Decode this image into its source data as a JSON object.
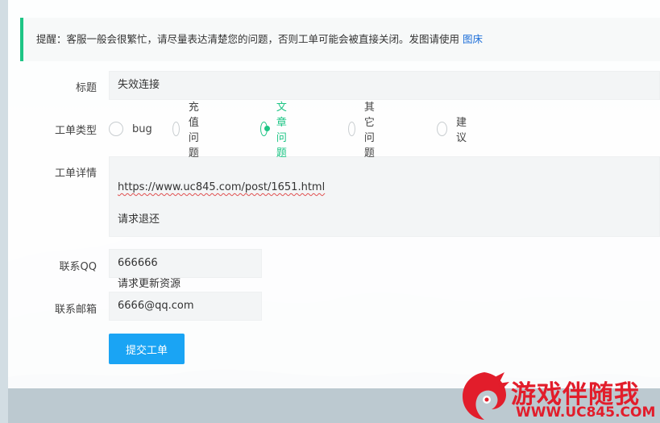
{
  "notice": {
    "text": "提醒：客服一般会很繁忙，请尽量表达清楚您的问题，否则工单可能会被直接关闭。发图请使用 ",
    "link_label": "图床"
  },
  "form": {
    "title_label": "标题",
    "title_value": "失效连接",
    "type_label": "工单类型",
    "types": [
      {
        "label": "bug",
        "checked": false
      },
      {
        "label": "充值问题",
        "checked": false
      },
      {
        "label": "文章问题",
        "checked": true
      },
      {
        "label": "其它问题",
        "checked": false
      },
      {
        "label": "建议",
        "checked": false
      }
    ],
    "detail_label": "工单详情",
    "detail_lines": [
      "https://www.uc845.com/post/1651.html",
      "请求退还",
      "",
      "请求更新资源"
    ],
    "qq_label": "联系QQ",
    "qq_value": "666666",
    "email_label": "联系邮箱",
    "email_value": "6666@qq.com",
    "submit_label": "提交工单"
  },
  "watermark": {
    "brand": "游戏伴随我",
    "url": "WWW.UC845.COM",
    "color": "#e21d2b"
  },
  "colors": {
    "accent": "#1ec585",
    "button": "#1aa4f4",
    "link": "#1e6fd9"
  }
}
